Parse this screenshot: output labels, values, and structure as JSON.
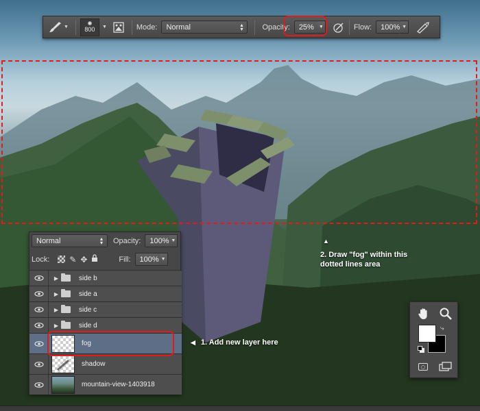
{
  "options_bar": {
    "brush_size": "800",
    "mode_label": "Mode:",
    "mode_value": "Normal",
    "opacity_label": "Opacity:",
    "opacity_value": "25%",
    "flow_label": "Flow:",
    "flow_value": "100%"
  },
  "layers_panel": {
    "blend_mode": "Normal",
    "opacity_label": "Opacity:",
    "opacity_value": "100%",
    "lock_label": "Lock:",
    "fill_label": "Fill:",
    "fill_value": "100%",
    "layers": [
      {
        "name": "side b",
        "type": "group"
      },
      {
        "name": "side a",
        "type": "group"
      },
      {
        "name": "side c",
        "type": "group"
      },
      {
        "name": "side d",
        "type": "group"
      },
      {
        "name": "fog",
        "type": "layer",
        "selected": true
      },
      {
        "name": "shadow",
        "type": "layer"
      },
      {
        "name": "mountain-view-1403918",
        "type": "image"
      }
    ]
  },
  "annotations": {
    "step1": "1. Add new layer here",
    "step2_line1": "2. Draw \"fog\" within this",
    "step2_line2": "dotted lines area"
  },
  "colors": {
    "highlight": "#e01b1b",
    "selected_layer": "#5e6e86",
    "foreground": "#ffffff",
    "background": "#000000"
  },
  "icons": [
    "brush-icon",
    "brush-panel-icon",
    "airbrush-icon",
    "tablet-pressure-icon",
    "eye-icon",
    "folder-icon",
    "hand-icon",
    "zoom-icon",
    "swap-colors-icon",
    "default-colors-icon",
    "quick-mask-icon",
    "screen-mode-icon"
  ]
}
